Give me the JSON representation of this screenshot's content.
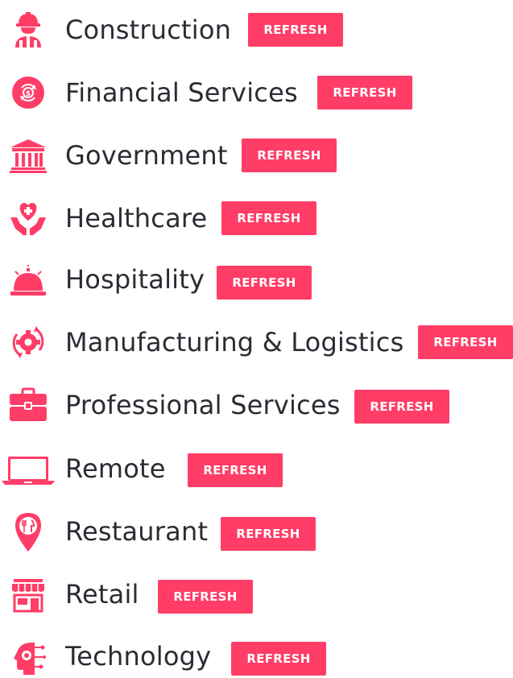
{
  "accent_color": "#ff3d67",
  "industries": [
    {
      "name": "Construction",
      "icon": "construction-worker-icon",
      "button": "REFRESH"
    },
    {
      "name": "Financial Services",
      "icon": "money-cycle-icon",
      "button": "REFRESH"
    },
    {
      "name": "Government",
      "icon": "government-building-icon",
      "button": "REFRESH"
    },
    {
      "name": "Healthcare",
      "icon": "heart-hands-icon",
      "button": "REFRESH"
    },
    {
      "name": "Hospitality",
      "icon": "service-bell-icon",
      "button": "REFRESH"
    },
    {
      "name": "Manufacturing & Logistics",
      "icon": "gear-cycle-icon",
      "button": "REFRESH"
    },
    {
      "name": "Professional Services",
      "icon": "briefcase-icon",
      "button": "REFRESH"
    },
    {
      "name": "Remote",
      "icon": "laptop-icon",
      "button": "REFRESH"
    },
    {
      "name": "Restaurant",
      "icon": "restaurant-pin-icon",
      "button": "REFRESH"
    },
    {
      "name": "Retail",
      "icon": "storefront-icon",
      "button": "REFRESH"
    },
    {
      "name": "Technology",
      "icon": "tech-head-icon",
      "button": "REFRESH"
    }
  ]
}
